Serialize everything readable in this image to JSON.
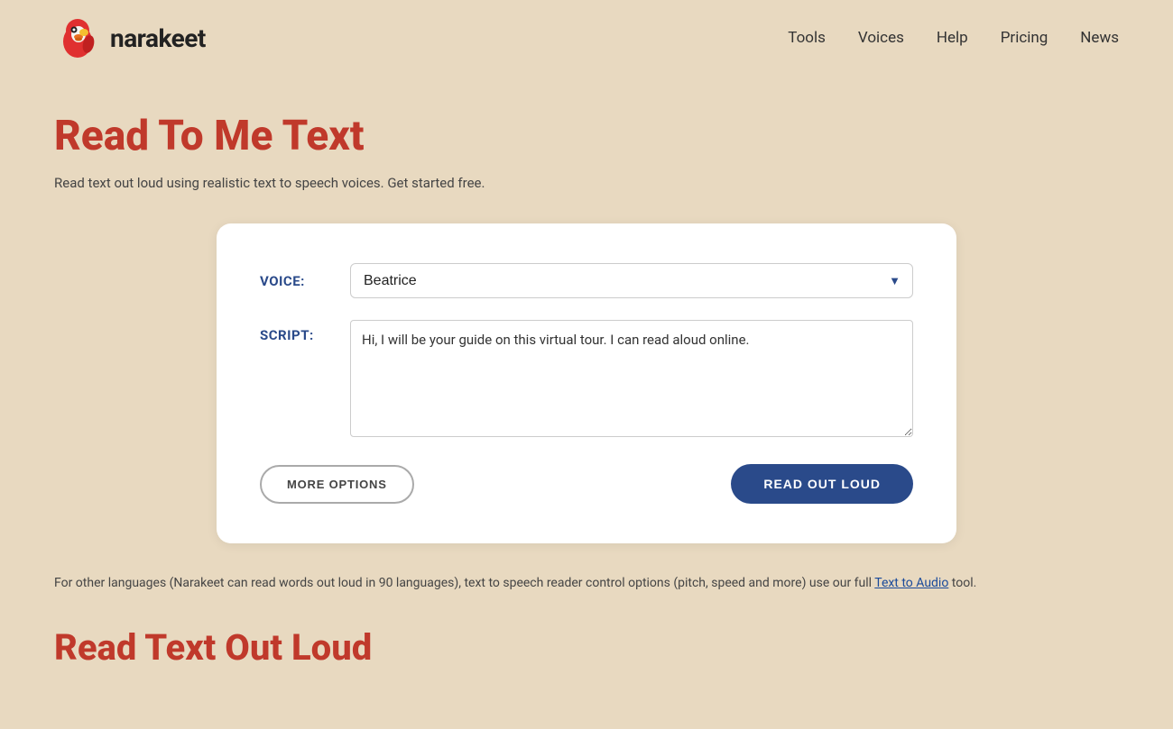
{
  "header": {
    "logo_text": "narakeet",
    "nav_items": [
      {
        "label": "Tools",
        "href": "#"
      },
      {
        "label": "Voices",
        "href": "#"
      },
      {
        "label": "Help",
        "href": "#"
      },
      {
        "label": "Pricing",
        "href": "#"
      },
      {
        "label": "News",
        "href": "#"
      }
    ]
  },
  "page": {
    "title": "Read To Me Text",
    "subtitle": "Read text out loud using realistic text to speech voices. Get started free.",
    "form": {
      "voice_label": "VOICE:",
      "voice_value": "Beatrice",
      "script_label": "SCRIPT:",
      "script_value": "Hi, I will be your guide on this virtual tour. I can read aloud online.",
      "btn_more_options": "MORE OPTIONS",
      "btn_read_out_loud": "READ OUT LOUD"
    },
    "footer_text_before_link": "For other languages (Narakeet can read words out loud in 90 languages), text to speech reader control options (pitch, speed and more) use our full ",
    "footer_link_text": "Text to Audio",
    "footer_text_after_link": " tool.",
    "section2_title": "Read Text Out Loud"
  }
}
